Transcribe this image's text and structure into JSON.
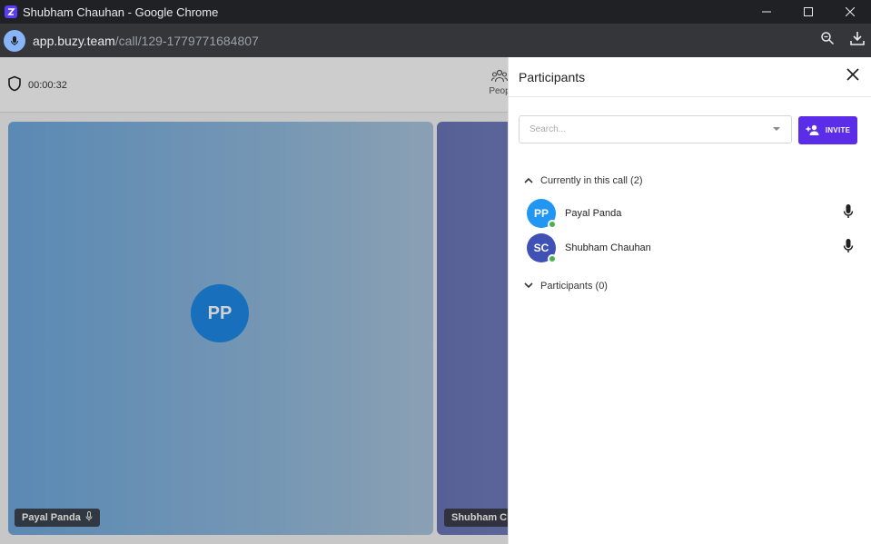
{
  "window": {
    "title": "Shubham Chauhan - Google Chrome"
  },
  "browser": {
    "url_host": "app.buzy.team",
    "url_path": "/call/129-1779771684807"
  },
  "call": {
    "timer": "00:00:32",
    "people_label": "Peop",
    "tiles": [
      {
        "initials": "PP",
        "name": "Payal Panda"
      },
      {
        "name": "Shubham Cha"
      }
    ]
  },
  "panel": {
    "title": "Participants",
    "search_placeholder": "Search...",
    "invite_label": "INVITE",
    "current_section": "Currently in this call (2)",
    "participants_section": "Participants (0)",
    "current": [
      {
        "initials": "PP",
        "name": "Payal Panda",
        "color": "#2196f3"
      },
      {
        "initials": "SC",
        "name": "Shubham Chauhan",
        "color": "#3f51b5"
      }
    ]
  },
  "colors": {
    "accent": "#5b2de8",
    "online": "#4caf50"
  }
}
